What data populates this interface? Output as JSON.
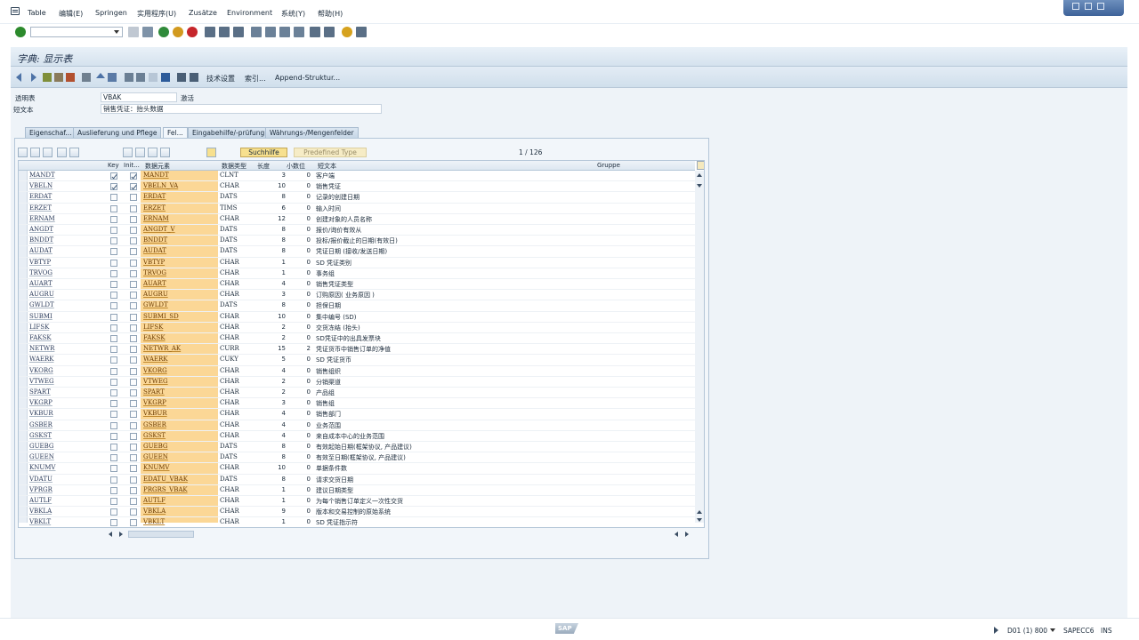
{
  "menubar": {
    "items": [
      "Table",
      "编辑(E)",
      "Springen",
      "实用程序(U)",
      "Zusätze",
      "Environment",
      "系统(Y)",
      "帮助(H)"
    ]
  },
  "title": "字典: 显示表",
  "app_toolbar": {
    "tech_settings": "技术设置",
    "index": "索引...",
    "append": "Append-Struktur..."
  },
  "header_fields": {
    "table_label": "透明表",
    "table_name": "VBAK",
    "status": "激活",
    "short_text_label": "短文本",
    "short_text": "销售凭证：抬头数据"
  },
  "tabs": [
    "Eigenschaf...",
    "Auslieferung und Pflege",
    "Fel...",
    "Eingabehilfe/-prüfung",
    "Währungs-/Mengenfelder"
  ],
  "table_toolbar": {
    "suchhilfe": "Suchhilfe",
    "predefined": "Predefined Type",
    "page": "1  /  126"
  },
  "columns": {
    "key": "Key",
    "init": "Init...",
    "element": "数据元素",
    "dtype": "数据类型",
    "length": "长度",
    "decimals": "小数位",
    "text": "短文本",
    "group": "Gruppe"
  },
  "rows": [
    {
      "field": "MANDT",
      "key": true,
      "init": true,
      "element": "MANDT",
      "dtype": "CLNT",
      "len": "3",
      "dec": "0",
      "text": "客户端"
    },
    {
      "field": "VBELN",
      "key": true,
      "init": true,
      "element": "VBELN_VA",
      "dtype": "CHAR",
      "len": "10",
      "dec": "0",
      "text": "销售凭证"
    },
    {
      "field": "ERDAT",
      "key": false,
      "init": false,
      "element": "ERDAT",
      "dtype": "DATS",
      "len": "8",
      "dec": "0",
      "text": "记录的创建日期"
    },
    {
      "field": "ERZET",
      "key": false,
      "init": false,
      "element": "ERZET",
      "dtype": "TIMS",
      "len": "6",
      "dec": "0",
      "text": "输入时间"
    },
    {
      "field": "ERNAM",
      "key": false,
      "init": false,
      "element": "ERNAM",
      "dtype": "CHAR",
      "len": "12",
      "dec": "0",
      "text": "创建对象的人员名称"
    },
    {
      "field": "ANGDT",
      "key": false,
      "init": false,
      "element": "ANGDT_V",
      "dtype": "DATS",
      "len": "8",
      "dec": "0",
      "text": "报价/询价有效从"
    },
    {
      "field": "BNDDT",
      "key": false,
      "init": false,
      "element": "BNDDT",
      "dtype": "DATS",
      "len": "8",
      "dec": "0",
      "text": "投标/报价截止的日期(有效日)"
    },
    {
      "field": "AUDAT",
      "key": false,
      "init": false,
      "element": "AUDAT",
      "dtype": "DATS",
      "len": "8",
      "dec": "0",
      "text": "凭证日期 (接收/发送日期)"
    },
    {
      "field": "VBTYP",
      "key": false,
      "init": false,
      "element": "VBTYP",
      "dtype": "CHAR",
      "len": "1",
      "dec": "0",
      "text": "SD 凭证类别"
    },
    {
      "field": "TRVOG",
      "key": false,
      "init": false,
      "element": "TRVOG",
      "dtype": "CHAR",
      "len": "1",
      "dec": "0",
      "text": "事务组"
    },
    {
      "field": "AUART",
      "key": false,
      "init": false,
      "element": "AUART",
      "dtype": "CHAR",
      "len": "4",
      "dec": "0",
      "text": "销售凭证类型"
    },
    {
      "field": "AUGRU",
      "key": false,
      "init": false,
      "element": "AUGRU",
      "dtype": "CHAR",
      "len": "3",
      "dec": "0",
      "text": "订购原因( 业务原因 )"
    },
    {
      "field": "GWLDT",
      "key": false,
      "init": false,
      "element": "GWLDT",
      "dtype": "DATS",
      "len": "8",
      "dec": "0",
      "text": "担保日期"
    },
    {
      "field": "SUBMI",
      "key": false,
      "init": false,
      "element": "SUBMI_SD",
      "dtype": "CHAR",
      "len": "10",
      "dec": "0",
      "text": "集中编号 (SD)"
    },
    {
      "field": "LIFSK",
      "key": false,
      "init": false,
      "element": "LIFSK",
      "dtype": "CHAR",
      "len": "2",
      "dec": "0",
      "text": "交货冻结 (抬头)"
    },
    {
      "field": "FAKSK",
      "key": false,
      "init": false,
      "element": "FAKSK",
      "dtype": "CHAR",
      "len": "2",
      "dec": "0",
      "text": "SD凭证中的出具发票块"
    },
    {
      "field": "NETWR",
      "key": false,
      "init": false,
      "element": "NETWR_AK",
      "dtype": "CURR",
      "len": "15",
      "dec": "2",
      "text": "凭证货币中销售订单的净值"
    },
    {
      "field": "WAERK",
      "key": false,
      "init": false,
      "element": "WAERK",
      "dtype": "CUKY",
      "len": "5",
      "dec": "0",
      "text": "SD 凭证货币"
    },
    {
      "field": "VKORG",
      "key": false,
      "init": false,
      "element": "VKORG",
      "dtype": "CHAR",
      "len": "4",
      "dec": "0",
      "text": "销售组织"
    },
    {
      "field": "VTWEG",
      "key": false,
      "init": false,
      "element": "VTWEG",
      "dtype": "CHAR",
      "len": "2",
      "dec": "0",
      "text": "分销渠道"
    },
    {
      "field": "SPART",
      "key": false,
      "init": false,
      "element": "SPART",
      "dtype": "CHAR",
      "len": "2",
      "dec": "0",
      "text": "产品组"
    },
    {
      "field": "VKGRP",
      "key": false,
      "init": false,
      "element": "VKGRP",
      "dtype": "CHAR",
      "len": "3",
      "dec": "0",
      "text": "销售组"
    },
    {
      "field": "VKBUR",
      "key": false,
      "init": false,
      "element": "VKBUR",
      "dtype": "CHAR",
      "len": "4",
      "dec": "0",
      "text": "销售部门"
    },
    {
      "field": "GSBER",
      "key": false,
      "init": false,
      "element": "GSBER",
      "dtype": "CHAR",
      "len": "4",
      "dec": "0",
      "text": "业务范围"
    },
    {
      "field": "GSKST",
      "key": false,
      "init": false,
      "element": "GSKST",
      "dtype": "CHAR",
      "len": "4",
      "dec": "0",
      "text": "来自成本中心的业务范围"
    },
    {
      "field": "GUEBG",
      "key": false,
      "init": false,
      "element": "GUEBG",
      "dtype": "DATS",
      "len": "8",
      "dec": "0",
      "text": "有效起始日期(框架协议, 产品建议)"
    },
    {
      "field": "GUEEN",
      "key": false,
      "init": false,
      "element": "GUEEN",
      "dtype": "DATS",
      "len": "8",
      "dec": "0",
      "text": "有效至日期(框架协议, 产品建议)"
    },
    {
      "field": "KNUMV",
      "key": false,
      "init": false,
      "element": "KNUMV",
      "dtype": "CHAR",
      "len": "10",
      "dec": "0",
      "text": "单据条件数"
    },
    {
      "field": "VDATU",
      "key": false,
      "init": false,
      "element": "EDATU_VBAK",
      "dtype": "DATS",
      "len": "8",
      "dec": "0",
      "text": "请求交货日期"
    },
    {
      "field": "VPRGR",
      "key": false,
      "init": false,
      "element": "PRGRS_VBAK",
      "dtype": "CHAR",
      "len": "1",
      "dec": "0",
      "text": "建议日期类型"
    },
    {
      "field": "AUTLF",
      "key": false,
      "init": false,
      "element": "AUTLF",
      "dtype": "CHAR",
      "len": "1",
      "dec": "0",
      "text": "为每个销售订单定义一次性交货"
    },
    {
      "field": "VBKLA",
      "key": false,
      "init": false,
      "element": "VBKLA",
      "dtype": "CHAR",
      "len": "9",
      "dec": "0",
      "text": "版本和交易控制的原始系统"
    },
    {
      "field": "VBKLT",
      "key": false,
      "init": false,
      "element": "VBKLT",
      "dtype": "CHAR",
      "len": "1",
      "dec": "0",
      "text": "SD 凭证指示符"
    }
  ],
  "statusbar": {
    "logo": "SAP",
    "system": "D01 (1) 800",
    "server": "SAPECC6",
    "mode": "INS"
  },
  "colors": {
    "element_column": "#fbd796",
    "title_bar": "#dbe7f2",
    "suchhilfe": "#f7e08e"
  }
}
